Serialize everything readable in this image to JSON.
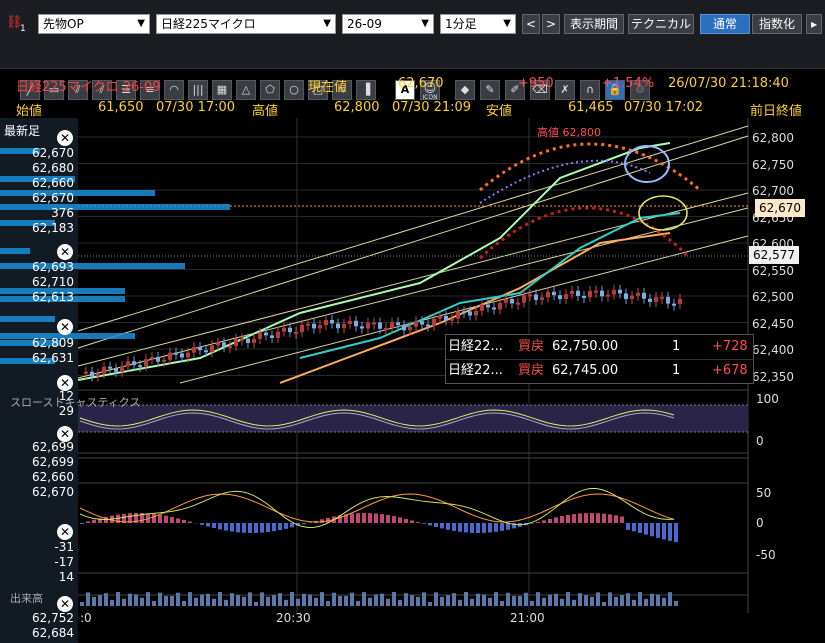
{
  "toolbar": {
    "link_icon": "link-icon",
    "link_num": "1",
    "market": "先物OP",
    "symbol": "日経225マイクロ",
    "contract": "26-09",
    "interval": "1分足",
    "prev": "<",
    "next": ">",
    "period_btn": "表示期間",
    "tech_btn": "テクニカル",
    "normal_btn": "通常",
    "index_btn": "指数化",
    "more_btn": "▸"
  },
  "tools": [
    "line-tool-icon",
    "ruler-icon",
    "parallel-lines-icon",
    "horizontal-lines-icon",
    "fib-lines-icon",
    "fan-icon",
    "vertical-lines-icon",
    "grid-icon",
    "triangle-icon",
    "pentagon-icon",
    "circle-icon",
    "square-icon",
    "text-icon",
    "smiley-icon",
    "icon-tool-icon",
    "tag-icon",
    "eraser-icon",
    "eraser-all-icon",
    "magnet-icon",
    "lock-icon",
    "settings-icon"
  ],
  "tool_text": {
    "text": "A",
    "icon": "ICON"
  },
  "header": {
    "name": "日経225マイクロ 26-09",
    "current_label": "現在値",
    "current": "62,670",
    "change": "+950",
    "change_pct": "+1.54%",
    "datetime": "26/07/30  21:18:40",
    "open_label": "始値",
    "open": "61,650",
    "open_time": "07/30  17:00",
    "high_label": "高値",
    "high": "62,800",
    "high_time": "07/30  21:09",
    "low_label": "安値",
    "low": "61,465",
    "low_time": "07/30  17:02",
    "prev_close_label": "前日終値"
  },
  "sidebar": {
    "title": "最新足",
    "groups": [
      [
        "62,670",
        "62,680",
        "62,660",
        "62,670",
        "376",
        "62,183"
      ],
      [
        "62,693",
        "62,710",
        "62,613"
      ],
      [
        "62,809",
        "62,631"
      ],
      [
        "12",
        "29"
      ],
      [
        "62,699",
        "62,699",
        "62,660",
        "62,670"
      ],
      [
        "-31",
        "-17",
        "14"
      ],
      [
        "62,752",
        "62,684"
      ]
    ],
    "sub_labels": [
      "スローストキャスティクス",
      "出来高"
    ],
    "close": "✕"
  },
  "price_axis": [
    "62,800",
    "62,750",
    "62,700",
    "62,650",
    "62,600",
    "62,550",
    "62,500",
    "62,450",
    "62,400",
    "62,350"
  ],
  "price_tags": {
    "current": "62,670",
    "line": "62,577"
  },
  "high_annotation": "高値 62,800",
  "stoch_axis": [
    "100",
    "0"
  ],
  "macd_axis": [
    "50",
    "0",
    "-50"
  ],
  "time_axis": [
    "20:30",
    "21:00"
  ],
  "time_axis_left": ":0",
  "depth": {
    "rows": [
      {
        "name": "日経22...",
        "side": "買戻",
        "price": "62,750.00",
        "qty": "1",
        "pl": "+728"
      },
      {
        "name": "日経22...",
        "side": "買戻",
        "price": "62,745.00",
        "qty": "1",
        "pl": "+678"
      }
    ]
  },
  "colors": {
    "up": "#d9534f",
    "down": "#5b8fd8",
    "accent": "#ff4040",
    "positive": "#ff4d4d",
    "blue_btn": "#2d6fbf"
  }
}
